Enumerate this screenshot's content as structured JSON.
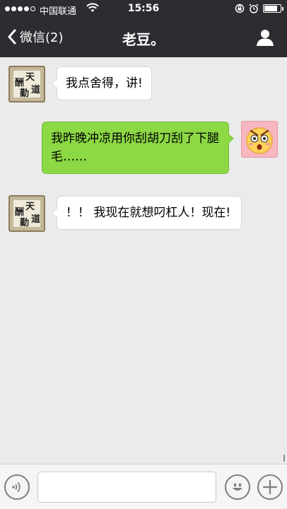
{
  "status_bar": {
    "carrier": "中国联通",
    "time": "15:56",
    "battery_level": 0.8
  },
  "nav": {
    "back_label": "微信(2)",
    "title": "老豆。",
    "back_icon": "chevron-left-icon",
    "profile_icon": "person-icon"
  },
  "messages": [
    {
      "direction": "incoming",
      "text": "我点舍得，讲!"
    },
    {
      "direction": "outgoing",
      "text": "我昨晚冲凉用你刮胡刀刮了下腿毛……"
    },
    {
      "direction": "incoming",
      "text": "！！ 我现在就想叼杠人！现在!"
    }
  ],
  "input_bar": {
    "voice_icon": "voice-icon",
    "emoji_icon": "emoji-icon",
    "plus_icon": "plus-icon",
    "text_value": ""
  },
  "colors": {
    "header_bg": "#2c2c31",
    "chat_bg": "#ebebeb",
    "outgoing_bubble": "#8cd845",
    "incoming_bubble": "#ffffff"
  }
}
